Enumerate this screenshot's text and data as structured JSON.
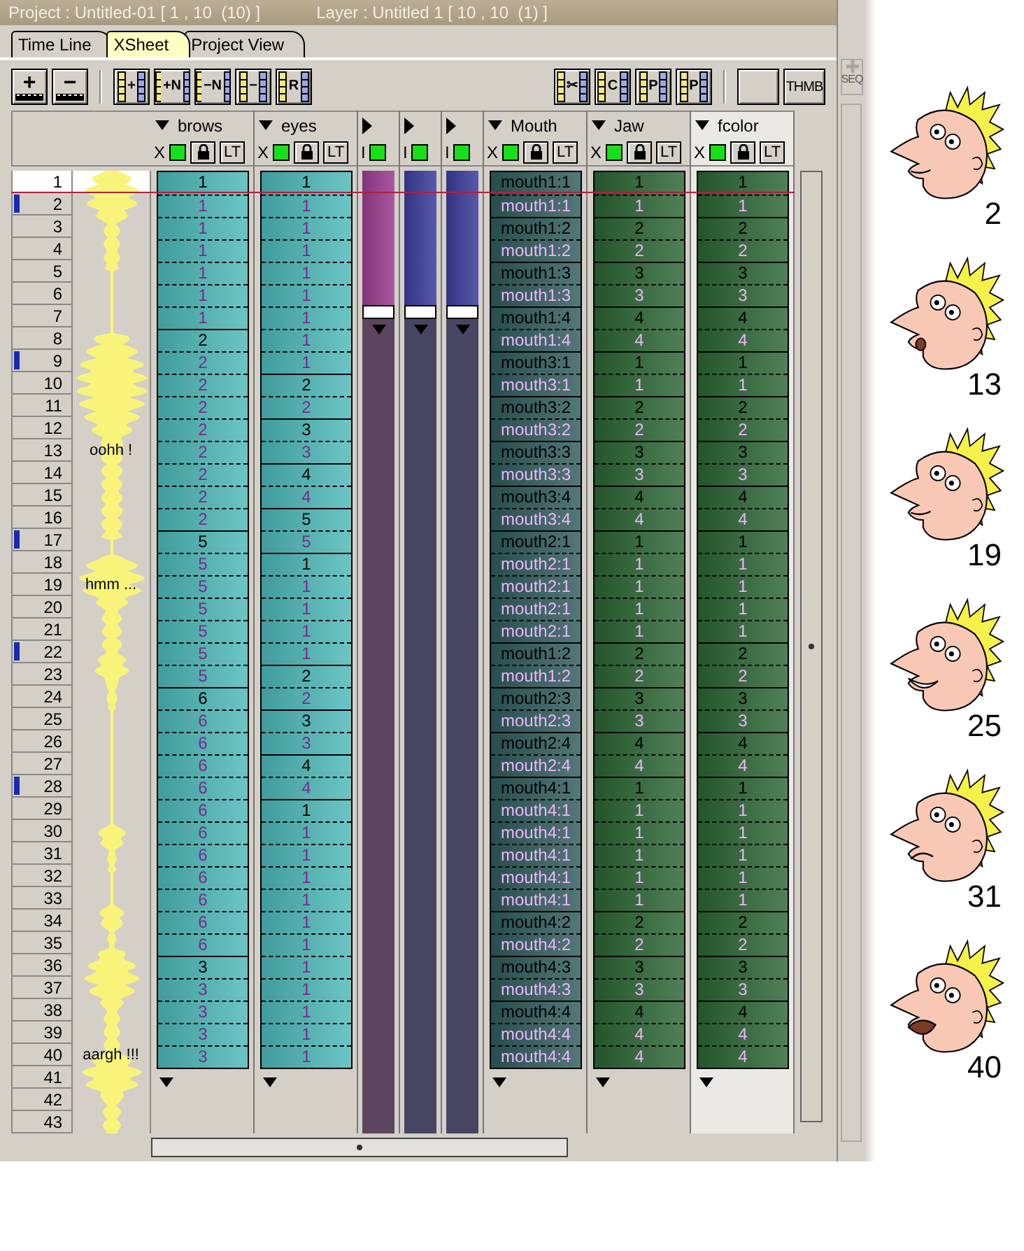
{
  "title_bar": {
    "project": "Project : Untitled-01 [ 1 , 10  (10) ]",
    "layer": "Layer : Untitled 1 [ 10 , 10  (1) ]"
  },
  "tabs": [
    {
      "label": "Time Line",
      "selected": false
    },
    {
      "label": "XSheet",
      "selected": true
    },
    {
      "label": "Project View",
      "selected": false
    }
  ],
  "toolbar": {
    "left": [
      [
        {
          "kind": "film",
          "label": "+"
        },
        {
          "kind": "film",
          "label": "−"
        }
      ],
      [
        {
          "kind": "strip",
          "label": "+"
        },
        {
          "kind": "strip",
          "label": "+N"
        },
        {
          "kind": "strip",
          "label": "−N"
        },
        {
          "kind": "strip",
          "label": "−"
        },
        {
          "kind": "strip",
          "label": "R"
        }
      ]
    ],
    "right": [
      [
        {
          "kind": "strip",
          "label": "✂"
        },
        {
          "kind": "strip",
          "label": "C"
        },
        {
          "kind": "strip",
          "label": "P"
        },
        {
          "kind": "strip",
          "label": "P"
        }
      ],
      [
        {
          "kind": "blank"
        },
        {
          "kind": "text",
          "label": "THMB"
        }
      ]
    ]
  },
  "side_panel": {
    "button": {
      "label": "SEQ",
      "disabled": true
    }
  },
  "layers": [
    {
      "kind": "data",
      "name": "brows",
      "toggle": "X",
      "lock": "LT",
      "dark": false,
      "color": "#4cb8b8",
      "visible": true,
      "selected": false
    },
    {
      "kind": "data",
      "name": "eyes",
      "toggle": "X",
      "lock": "LT",
      "dark": false,
      "color": "#4cb8b8",
      "visible": true,
      "selected": false
    },
    {
      "kind": "strip",
      "toggle": "I",
      "color": "#9a3c8e",
      "visible": true
    },
    {
      "kind": "strip",
      "toggle": "I",
      "color": "#3c3c9a",
      "visible": true
    },
    {
      "kind": "strip",
      "toggle": "I",
      "color": "#3c3c9a",
      "visible": true
    },
    {
      "kind": "data",
      "name": "Mouth",
      "toggle": "X",
      "lock": "LT",
      "dark": true,
      "color": "#2e5a5a",
      "visible": true,
      "selected": false
    },
    {
      "kind": "data",
      "name": "Jaw",
      "toggle": "X",
      "lock": "LT",
      "dark": true,
      "color": "#2a6432",
      "visible": true,
      "selected": false
    },
    {
      "kind": "data",
      "name": "fcolor",
      "toggle": "X",
      "lock": "LT",
      "dark": true,
      "color": "#2a6432",
      "visible": true,
      "selected": true
    }
  ],
  "rows": [
    {
      "frame": "1",
      "selected": true,
      "marked": false,
      "cells": [
        {
          "text": "1",
          "key": true
        },
        {
          "text": "1",
          "key": true
        },
        {
          "text": "mouth1:1",
          "key": true
        },
        {
          "text": "1",
          "key": true
        },
        {
          "text": "1",
          "key": true
        }
      ]
    },
    {
      "frame": "2",
      "selected": false,
      "marked": true,
      "cells": [
        {
          "text": "1",
          "key": false
        },
        {
          "text": "1",
          "key": false
        },
        {
          "text": "mouth1:1",
          "key": false
        },
        {
          "text": "1",
          "key": false
        },
        {
          "text": "1",
          "key": false
        }
      ]
    },
    {
      "frame": "3",
      "selected": false,
      "marked": false,
      "cells": [
        {
          "text": "1",
          "key": false
        },
        {
          "text": "1",
          "key": false
        },
        {
          "text": "mouth1:2",
          "key": true
        },
        {
          "text": "2",
          "key": true
        },
        {
          "text": "2",
          "key": true
        }
      ]
    },
    {
      "frame": "4",
      "selected": false,
      "marked": false,
      "cells": [
        {
          "text": "1",
          "key": false
        },
        {
          "text": "1",
          "key": false
        },
        {
          "text": "mouth1:2",
          "key": false
        },
        {
          "text": "2",
          "key": false
        },
        {
          "text": "2",
          "key": false
        }
      ]
    },
    {
      "frame": "5",
      "selected": false,
      "marked": false,
      "cells": [
        {
          "text": "1",
          "key": false
        },
        {
          "text": "1",
          "key": false
        },
        {
          "text": "mouth1:3",
          "key": true
        },
        {
          "text": "3",
          "key": true
        },
        {
          "text": "3",
          "key": true
        }
      ]
    },
    {
      "frame": "6",
      "selected": false,
      "marked": false,
      "cells": [
        {
          "text": "1",
          "key": false
        },
        {
          "text": "1",
          "key": false
        },
        {
          "text": "mouth1:3",
          "key": false
        },
        {
          "text": "3",
          "key": false
        },
        {
          "text": "3",
          "key": false
        }
      ]
    },
    {
      "frame": "7",
      "selected": false,
      "marked": false,
      "cells": [
        {
          "text": "1",
          "key": false
        },
        {
          "text": "1",
          "key": false
        },
        {
          "text": "mouth1:4",
          "key": true
        },
        {
          "text": "4",
          "key": true
        },
        {
          "text": "4",
          "key": true
        }
      ]
    },
    {
      "frame": "8",
      "selected": false,
      "marked": false,
      "cells": [
        {
          "text": "2",
          "key": true
        },
        {
          "text": "1",
          "key": false
        },
        {
          "text": "mouth1:4",
          "key": false
        },
        {
          "text": "4",
          "key": false
        },
        {
          "text": "4",
          "key": false
        }
      ]
    },
    {
      "frame": "9",
      "selected": false,
      "marked": true,
      "cells": [
        {
          "text": "2",
          "key": false
        },
        {
          "text": "1",
          "key": false
        },
        {
          "text": "mouth3:1",
          "key": true
        },
        {
          "text": "1",
          "key": true
        },
        {
          "text": "1",
          "key": true
        }
      ]
    },
    {
      "frame": "10",
      "selected": false,
      "marked": false,
      "cells": [
        {
          "text": "2",
          "key": false
        },
        {
          "text": "2",
          "key": true
        },
        {
          "text": "mouth3:1",
          "key": false
        },
        {
          "text": "1",
          "key": false
        },
        {
          "text": "1",
          "key": false
        }
      ]
    },
    {
      "frame": "11",
      "selected": false,
      "marked": false,
      "cells": [
        {
          "text": "2",
          "key": false
        },
        {
          "text": "2",
          "key": false
        },
        {
          "text": "mouth3:2",
          "key": true
        },
        {
          "text": "2",
          "key": true
        },
        {
          "text": "2",
          "key": true
        }
      ]
    },
    {
      "frame": "12",
      "selected": false,
      "marked": false,
      "cells": [
        {
          "text": "2",
          "key": false
        },
        {
          "text": "3",
          "key": true
        },
        {
          "text": "mouth3:2",
          "key": false
        },
        {
          "text": "2",
          "key": false
        },
        {
          "text": "2",
          "key": false
        }
      ]
    },
    {
      "frame": "13",
      "selected": false,
      "marked": false,
      "sound": "oohh !",
      "cells": [
        {
          "text": "2",
          "key": false
        },
        {
          "text": "3",
          "key": false
        },
        {
          "text": "mouth3:3",
          "key": true
        },
        {
          "text": "3",
          "key": true
        },
        {
          "text": "3",
          "key": true
        }
      ]
    },
    {
      "frame": "14",
      "selected": false,
      "marked": false,
      "cells": [
        {
          "text": "2",
          "key": false
        },
        {
          "text": "4",
          "key": true
        },
        {
          "text": "mouth3:3",
          "key": false
        },
        {
          "text": "3",
          "key": false
        },
        {
          "text": "3",
          "key": false
        }
      ]
    },
    {
      "frame": "15",
      "selected": false,
      "marked": false,
      "cells": [
        {
          "text": "2",
          "key": false
        },
        {
          "text": "4",
          "key": false
        },
        {
          "text": "mouth3:4",
          "key": true
        },
        {
          "text": "4",
          "key": true
        },
        {
          "text": "4",
          "key": true
        }
      ]
    },
    {
      "frame": "16",
      "selected": false,
      "marked": false,
      "cells": [
        {
          "text": "2",
          "key": false
        },
        {
          "text": "5",
          "key": true
        },
        {
          "text": "mouth3:4",
          "key": false
        },
        {
          "text": "4",
          "key": false
        },
        {
          "text": "4",
          "key": false
        }
      ]
    },
    {
      "frame": "17",
      "selected": false,
      "marked": true,
      "cells": [
        {
          "text": "5",
          "key": true
        },
        {
          "text": "5",
          "key": false
        },
        {
          "text": "mouth2:1",
          "key": true
        },
        {
          "text": "1",
          "key": true
        },
        {
          "text": "1",
          "key": true
        }
      ]
    },
    {
      "frame": "18",
      "selected": false,
      "marked": false,
      "cells": [
        {
          "text": "5",
          "key": false
        },
        {
          "text": "1",
          "key": true
        },
        {
          "text": "mouth2:1",
          "key": false
        },
        {
          "text": "1",
          "key": false
        },
        {
          "text": "1",
          "key": false
        }
      ]
    },
    {
      "frame": "19",
      "selected": false,
      "marked": false,
      "sound": "hmm ...",
      "cells": [
        {
          "text": "5",
          "key": false
        },
        {
          "text": "1",
          "key": false
        },
        {
          "text": "mouth2:1",
          "key": false
        },
        {
          "text": "1",
          "key": false
        },
        {
          "text": "1",
          "key": false
        }
      ]
    },
    {
      "frame": "20",
      "selected": false,
      "marked": false,
      "cells": [
        {
          "text": "5",
          "key": false
        },
        {
          "text": "1",
          "key": false
        },
        {
          "text": "mouth2:1",
          "key": false
        },
        {
          "text": "1",
          "key": false
        },
        {
          "text": "1",
          "key": false
        }
      ]
    },
    {
      "frame": "21",
      "selected": false,
      "marked": false,
      "cells": [
        {
          "text": "5",
          "key": false
        },
        {
          "text": "1",
          "key": false
        },
        {
          "text": "mouth2:1",
          "key": false
        },
        {
          "text": "1",
          "key": false
        },
        {
          "text": "1",
          "key": false
        }
      ]
    },
    {
      "frame": "22",
      "selected": false,
      "marked": true,
      "cells": [
        {
          "text": "5",
          "key": false
        },
        {
          "text": "1",
          "key": false
        },
        {
          "text": "mouth1:2",
          "key": true
        },
        {
          "text": "2",
          "key": true
        },
        {
          "text": "2",
          "key": true
        }
      ]
    },
    {
      "frame": "23",
      "selected": false,
      "marked": false,
      "cells": [
        {
          "text": "5",
          "key": false
        },
        {
          "text": "2",
          "key": true
        },
        {
          "text": "mouth1:2",
          "key": false
        },
        {
          "text": "2",
          "key": false
        },
        {
          "text": "2",
          "key": false
        }
      ]
    },
    {
      "frame": "24",
      "selected": false,
      "marked": false,
      "cells": [
        {
          "text": "6",
          "key": true
        },
        {
          "text": "2",
          "key": false
        },
        {
          "text": "mouth2:3",
          "key": true
        },
        {
          "text": "3",
          "key": true
        },
        {
          "text": "3",
          "key": true
        }
      ]
    },
    {
      "frame": "25",
      "selected": false,
      "marked": false,
      "cells": [
        {
          "text": "6",
          "key": false
        },
        {
          "text": "3",
          "key": true
        },
        {
          "text": "mouth2:3",
          "key": false
        },
        {
          "text": "3",
          "key": false
        },
        {
          "text": "3",
          "key": false
        }
      ]
    },
    {
      "frame": "26",
      "selected": false,
      "marked": false,
      "cells": [
        {
          "text": "6",
          "key": false
        },
        {
          "text": "3",
          "key": false
        },
        {
          "text": "mouth2:4",
          "key": true
        },
        {
          "text": "4",
          "key": true
        },
        {
          "text": "4",
          "key": true
        }
      ]
    },
    {
      "frame": "27",
      "selected": false,
      "marked": false,
      "cells": [
        {
          "text": "6",
          "key": false
        },
        {
          "text": "4",
          "key": true
        },
        {
          "text": "mouth2:4",
          "key": false
        },
        {
          "text": "4",
          "key": false
        },
        {
          "text": "4",
          "key": false
        }
      ]
    },
    {
      "frame": "28",
      "selected": false,
      "marked": true,
      "cells": [
        {
          "text": "6",
          "key": false
        },
        {
          "text": "4",
          "key": false
        },
        {
          "text": "mouth4:1",
          "key": true
        },
        {
          "text": "1",
          "key": true
        },
        {
          "text": "1",
          "key": true
        }
      ]
    },
    {
      "frame": "29",
      "selected": false,
      "marked": false,
      "cells": [
        {
          "text": "6",
          "key": false
        },
        {
          "text": "1",
          "key": true
        },
        {
          "text": "mouth4:1",
          "key": false
        },
        {
          "text": "1",
          "key": false
        },
        {
          "text": "1",
          "key": false
        }
      ]
    },
    {
      "frame": "30",
      "selected": false,
      "marked": false,
      "cells": [
        {
          "text": "6",
          "key": false
        },
        {
          "text": "1",
          "key": false
        },
        {
          "text": "mouth4:1",
          "key": false
        },
        {
          "text": "1",
          "key": false
        },
        {
          "text": "1",
          "key": false
        }
      ]
    },
    {
      "frame": "31",
      "selected": false,
      "marked": false,
      "cells": [
        {
          "text": "6",
          "key": false
        },
        {
          "text": "1",
          "key": false
        },
        {
          "text": "mouth4:1",
          "key": false
        },
        {
          "text": "1",
          "key": false
        },
        {
          "text": "1",
          "key": false
        }
      ]
    },
    {
      "frame": "32",
      "selected": false,
      "marked": false,
      "cells": [
        {
          "text": "6",
          "key": false
        },
        {
          "text": "1",
          "key": false
        },
        {
          "text": "mouth4:1",
          "key": false
        },
        {
          "text": "1",
          "key": false
        },
        {
          "text": "1",
          "key": false
        }
      ]
    },
    {
      "frame": "33",
      "selected": false,
      "marked": false,
      "cells": [
        {
          "text": "6",
          "key": false
        },
        {
          "text": "1",
          "key": false
        },
        {
          "text": "mouth4:1",
          "key": false
        },
        {
          "text": "1",
          "key": false
        },
        {
          "text": "1",
          "key": false
        }
      ]
    },
    {
      "frame": "34",
      "selected": false,
      "marked": false,
      "cells": [
        {
          "text": "6",
          "key": false
        },
        {
          "text": "1",
          "key": false
        },
        {
          "text": "mouth4:2",
          "key": true
        },
        {
          "text": "2",
          "key": true
        },
        {
          "text": "2",
          "key": true
        }
      ]
    },
    {
      "frame": "35",
      "selected": false,
      "marked": false,
      "cells": [
        {
          "text": "6",
          "key": false
        },
        {
          "text": "1",
          "key": false
        },
        {
          "text": "mouth4:2",
          "key": false
        },
        {
          "text": "2",
          "key": false
        },
        {
          "text": "2",
          "key": false
        }
      ]
    },
    {
      "frame": "36",
      "selected": false,
      "marked": false,
      "cells": [
        {
          "text": "3",
          "key": true
        },
        {
          "text": "1",
          "key": false
        },
        {
          "text": "mouth4:3",
          "key": true
        },
        {
          "text": "3",
          "key": true
        },
        {
          "text": "3",
          "key": true
        }
      ]
    },
    {
      "frame": "37",
      "selected": false,
      "marked": false,
      "cells": [
        {
          "text": "3",
          "key": false
        },
        {
          "text": "1",
          "key": false
        },
        {
          "text": "mouth4:3",
          "key": false
        },
        {
          "text": "3",
          "key": false
        },
        {
          "text": "3",
          "key": false
        }
      ]
    },
    {
      "frame": "38",
      "selected": false,
      "marked": false,
      "cells": [
        {
          "text": "3",
          "key": false
        },
        {
          "text": "1",
          "key": false
        },
        {
          "text": "mouth4:4",
          "key": true
        },
        {
          "text": "4",
          "key": true
        },
        {
          "text": "4",
          "key": true
        }
      ]
    },
    {
      "frame": "39",
      "selected": false,
      "marked": false,
      "cells": [
        {
          "text": "3",
          "key": false
        },
        {
          "text": "1",
          "key": false
        },
        {
          "text": "mouth4:4",
          "key": false
        },
        {
          "text": "4",
          "key": false
        },
        {
          "text": "4",
          "key": false
        }
      ]
    },
    {
      "frame": "40",
      "selected": false,
      "marked": false,
      "sound": "aargh !!!",
      "cells": [
        {
          "text": "3",
          "key": false
        },
        {
          "text": "1",
          "key": false
        },
        {
          "text": "mouth4:4",
          "key": false
        },
        {
          "text": "4",
          "key": false
        },
        {
          "text": "4",
          "key": false
        }
      ]
    },
    {
      "frame": "41",
      "selected": false,
      "marked": false
    },
    {
      "frame": "42",
      "selected": false,
      "marked": false
    },
    {
      "frame": "43",
      "selected": false,
      "marked": false
    }
  ],
  "faces": [
    {
      "label": "2",
      "kind": "closed"
    },
    {
      "label": "13",
      "kind": "open"
    },
    {
      "label": "19",
      "kind": "closed"
    },
    {
      "label": "25",
      "kind": "smile"
    },
    {
      "label": "31",
      "kind": "frown"
    },
    {
      "label": "40",
      "kind": "gasp"
    }
  ]
}
